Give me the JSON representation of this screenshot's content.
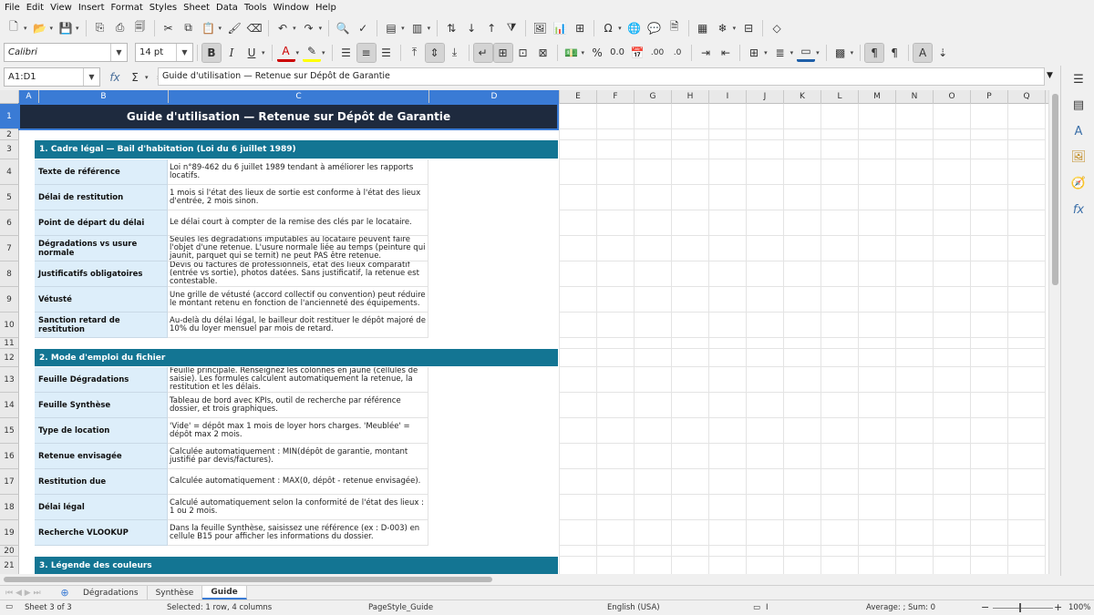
{
  "menu": [
    "File",
    "Edit",
    "View",
    "Insert",
    "Format",
    "Styles",
    "Sheet",
    "Data",
    "Tools",
    "Window",
    "Help"
  ],
  "toolbar": {
    "font_name": "Calibri",
    "font_size": "14 pt"
  },
  "formula_bar": {
    "name_box": "A1:D1",
    "content": "Guide d'utilisation — Retenue sur Dépôt de Garantie"
  },
  "columns": [
    "A",
    "B",
    "C",
    "D",
    "E",
    "F",
    "G",
    "H",
    "I",
    "J",
    "K",
    "L",
    "M",
    "N",
    "O",
    "P",
    "Q"
  ],
  "rows": [
    "1",
    "2",
    "3",
    "4",
    "5",
    "6",
    "7",
    "8",
    "9",
    "10",
    "11",
    "12",
    "13",
    "14",
    "15",
    "16",
    "17",
    "18",
    "19",
    "20",
    "21"
  ],
  "sheet": {
    "title": "Guide d'utilisation — Retenue sur Dépôt de Garantie",
    "section1": {
      "title": "1. Cadre légal — Bail d'habitation (Loi du 6 juillet 1989)",
      "items": [
        {
          "label": "Texte de référence",
          "value": "Loi n°89-462 du 6 juillet 1989 tendant à améliorer les rapports locatifs."
        },
        {
          "label": "Délai de restitution",
          "value": "1 mois si l'état des lieux de sortie est conforme à l'état des lieux d'entrée, 2 mois sinon."
        },
        {
          "label": "Point de départ du délai",
          "value": "Le délai court à compter de la remise des clés par le locataire."
        },
        {
          "label": "Dégradations vs usure normale",
          "value": "Seules les dégradations imputables au locataire peuvent faire l'objet d'une retenue. L'usure normale liée au temps (peinture qui jaunit, parquet qui se ternit) ne peut PAS être retenue."
        },
        {
          "label": "Justificatifs obligatoires",
          "value": "Devis ou factures de professionnels, état des lieux comparatif (entrée vs sortie), photos datées. Sans justificatif, la retenue est contestable."
        },
        {
          "label": "Vétusté",
          "value": "Une grille de vétusté (accord collectif ou convention) peut réduire le montant retenu en fonction de l'ancienneté des équipements."
        },
        {
          "label": "Sanction retard de restitution",
          "value": "Au-delà du délai légal, le bailleur doit restituer le dépôt majoré de 10% du loyer mensuel par mois de retard."
        }
      ]
    },
    "section2": {
      "title": "2. Mode d'emploi du fichier",
      "items": [
        {
          "label": "Feuille Dégradations",
          "value": "Feuille principale. Renseignez les colonnes en jaune (cellules de saisie). Les formules calculent automatiquement la retenue, la restitution et les délais."
        },
        {
          "label": "Feuille Synthèse",
          "value": "Tableau de bord avec KPIs, outil de recherche par référence dossier, et trois graphiques."
        },
        {
          "label": "Type de location",
          "value": "'Vide' = dépôt max 1 mois de loyer hors charges. 'Meublée' = dépôt max 2 mois."
        },
        {
          "label": "Retenue envisagée",
          "value": "Calculée automatiquement : MIN(dépôt de garantie, montant justifié par devis/factures)."
        },
        {
          "label": "Restitution due",
          "value": "Calculée automatiquement : MAX(0, dépôt - retenue envisagée)."
        },
        {
          "label": "Délai légal",
          "value": "Calculé automatiquement selon la conformité de l'état des lieux : 1 ou 2 mois."
        },
        {
          "label": "Recherche VLOOKUP",
          "value": "Dans la feuille Synthèse, saisissez une référence (ex : D-003) en cellule B15 pour afficher les informations du dossier."
        }
      ]
    },
    "section3": {
      "title": "3. Légende des couleurs"
    }
  },
  "tabs": [
    "Dégradations",
    "Synthèse",
    "Guide"
  ],
  "active_tab": "Guide",
  "status": {
    "sheet": "Sheet 3 of 3",
    "selection": "Selected: 1 row, 4 columns",
    "page_style": "PageStyle_Guide",
    "language": "English (USA)",
    "sum": "Average: ; Sum: 0",
    "zoom": "100%"
  },
  "colors": {
    "title_bg": "#1e2a3e",
    "section_bg": "#137593",
    "label_bg": "#ddeefa",
    "selection": "#3a7bd5"
  }
}
